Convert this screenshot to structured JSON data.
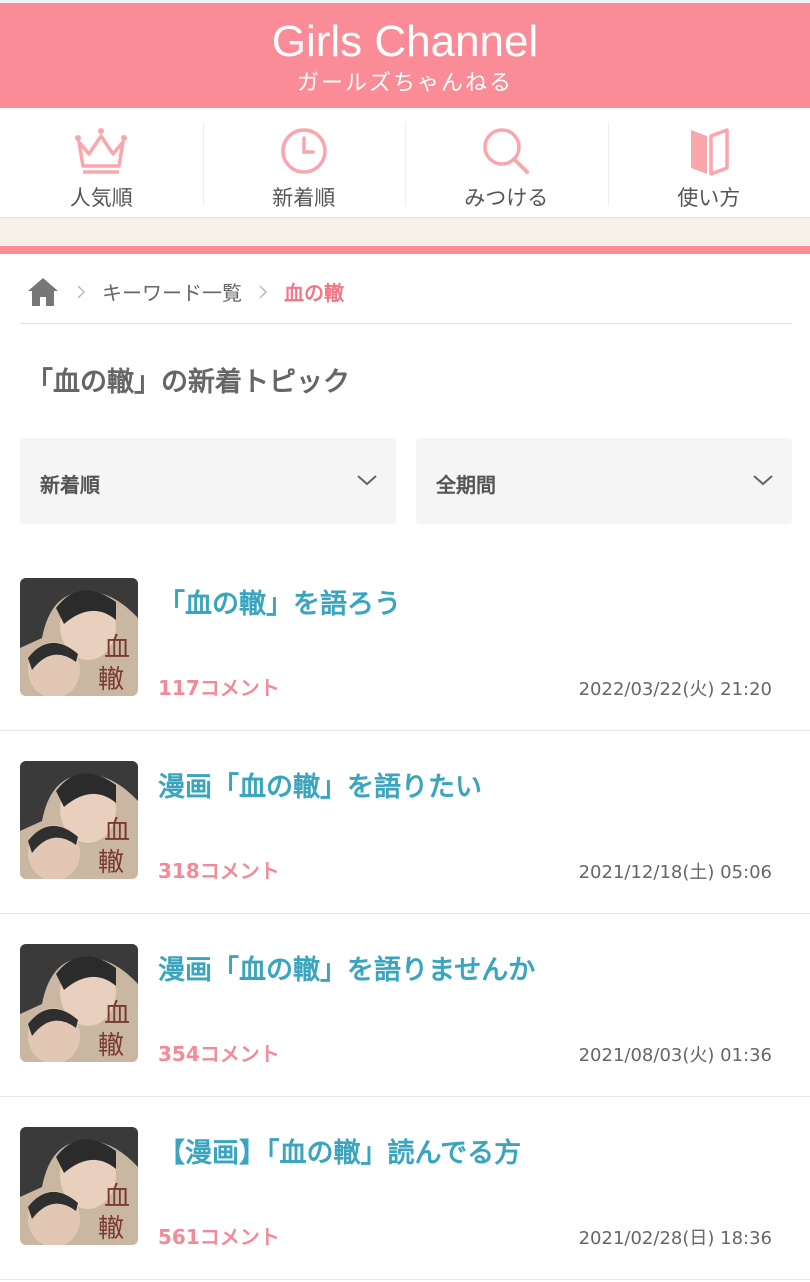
{
  "header": {
    "logo_en": "Girls Channel",
    "logo_ja": "ガールズちゃんねる",
    "background": "#f98c96"
  },
  "nav": {
    "items": [
      {
        "label": "人気順",
        "icon": "crown-icon"
      },
      {
        "label": "新着順",
        "icon": "clock-icon"
      },
      {
        "label": "みつける",
        "icon": "search-icon"
      },
      {
        "label": "使い方",
        "icon": "book-icon"
      }
    ]
  },
  "breadcrumb": {
    "items": [
      "キーワード一覧"
    ],
    "current": "血の轍"
  },
  "page_title": "「血の轍」の新着トピック",
  "filters": {
    "sort": "新着順",
    "period": "全期間"
  },
  "topics": [
    {
      "title": "「血の轍」を語ろう",
      "comments": "117コメント",
      "date": "2022/03/22(火) 21:20"
    },
    {
      "title": "漫画「血の轍」を語りたい",
      "comments": "318コメント",
      "date": "2021/12/18(土) 05:06"
    },
    {
      "title": "漫画「血の轍」を語りませんか",
      "comments": "354コメント",
      "date": "2021/08/03(火) 01:36"
    },
    {
      "title": "【漫画】「血の轍」読んでる方",
      "comments": "561コメント",
      "date": "2021/02/28(日) 18:36"
    }
  ],
  "colors": {
    "accent": "#f98c96",
    "topic_title": "#3aa5be",
    "comment_count": "#f28a97",
    "beige": "#f6f1e6"
  }
}
